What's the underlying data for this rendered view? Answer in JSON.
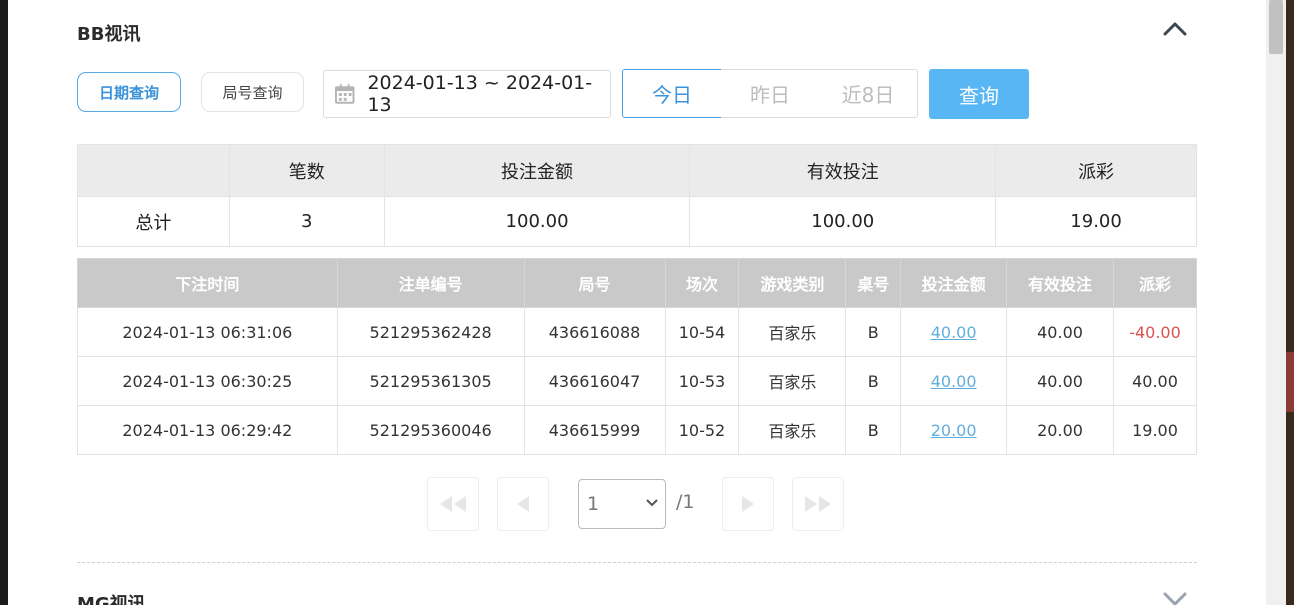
{
  "section": {
    "title": "BB视讯"
  },
  "tabs": {
    "date_query": "日期查询",
    "round_query": "局号查询"
  },
  "date_range": {
    "value": "2024-01-13 ~ 2024-01-13"
  },
  "quick_filters": {
    "today": "今日",
    "yesterday": "昨日",
    "last8": "近8日"
  },
  "query_button": "查询",
  "summary": {
    "headers": [
      "",
      "笔数",
      "投注金额",
      "有效投注",
      "派彩"
    ],
    "row": {
      "label": "总计",
      "count": "3",
      "bet": "100.00",
      "valid": "100.00",
      "payout": "19.00"
    }
  },
  "detail": {
    "headers": [
      "下注时间",
      "注单编号",
      "局号",
      "场次",
      "游戏类别",
      "桌号",
      "投注金额",
      "有效投注",
      "派彩"
    ],
    "rows": [
      {
        "time": "2024-01-13 06:31:06",
        "order": "521295362428",
        "round": "436616088",
        "game_no": "10-54",
        "category": "百家乐",
        "table": "B",
        "bet": "40.00",
        "valid": "40.00",
        "payout": "-40.00"
      },
      {
        "time": "2024-01-13 06:30:25",
        "order": "521295361305",
        "round": "436616047",
        "game_no": "10-53",
        "category": "百家乐",
        "table": "B",
        "bet": "40.00",
        "valid": "40.00",
        "payout": "40.00"
      },
      {
        "time": "2024-01-13 06:29:42",
        "order": "521295360046",
        "round": "436615999",
        "game_no": "10-52",
        "category": "百家乐",
        "table": "B",
        "bet": "20.00",
        "valid": "20.00",
        "payout": "19.00"
      }
    ]
  },
  "pagination": {
    "current": "1",
    "total": "/1"
  },
  "next_section": {
    "title": "MG视讯"
  },
  "icons": {
    "calendar": "calendar-icon",
    "collapse": "chevron-up-icon",
    "expand": "chevron-down-icon"
  },
  "colors": {
    "accent": "#3b93dc",
    "query_button": "#58b6f5",
    "negative": "#d9534f",
    "link": "#62aede",
    "table_header": "#c9c9c9"
  }
}
